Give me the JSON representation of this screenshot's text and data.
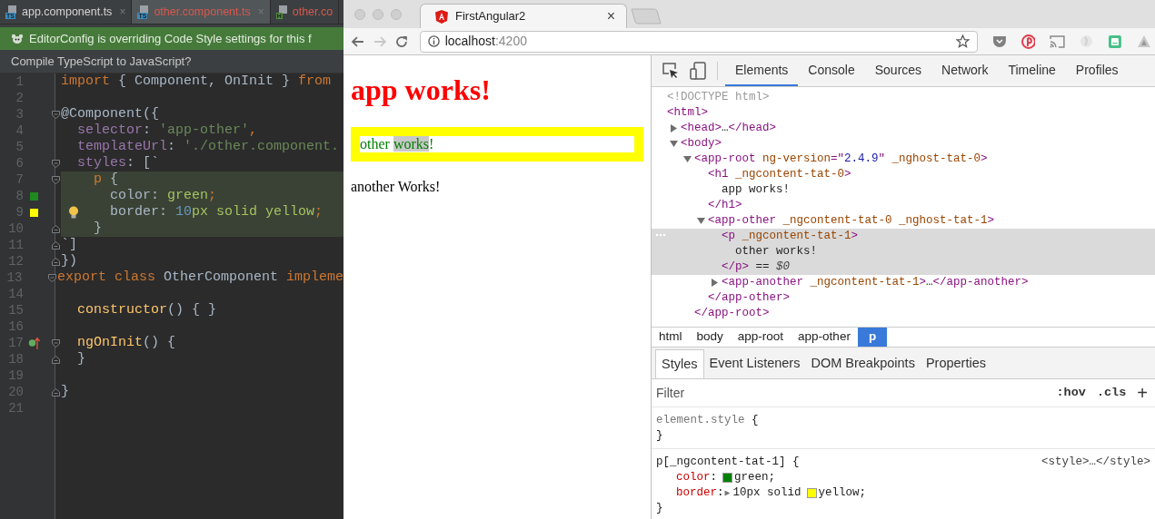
{
  "ide": {
    "tabs": [
      {
        "label": "app.component.ts",
        "file_type": "TS",
        "color": "#3b8ec2",
        "error": false,
        "selected": false,
        "close": "×"
      },
      {
        "label": "other.component.ts",
        "file_type": "TS",
        "color": "#3b8ec2",
        "error": true,
        "selected": true,
        "close": "×"
      },
      {
        "label": "other.co",
        "file_type": "H",
        "color": "#4e8f3a",
        "error": true,
        "selected": false
      }
    ],
    "notification": "EditorConfig is overriding Code Style settings for this f",
    "prompt": "Compile TypeScript to JavaScript?",
    "lines": [
      {
        "n": "1",
        "tokens": [
          {
            "text": "import",
            "kind": "kw"
          },
          {
            "text": " { Component, OnInit } ",
            "kind": "plain"
          },
          {
            "text": "from",
            "kind": "kw"
          }
        ],
        "highlighted": false
      },
      {
        "n": "2",
        "highlighted": false
      },
      {
        "n": "3",
        "tokens": [
          {
            "text": "@Component({",
            "kind": "plain"
          }
        ],
        "fold_start": true,
        "highlighted": false
      },
      {
        "n": "4",
        "tokens": [
          {
            "text": "  selector",
            "kind": "prop"
          },
          {
            "text": ": ",
            "kind": "plain"
          },
          {
            "text": "'app-other'",
            "kind": "str"
          },
          {
            "text": ",",
            "kind": "kw"
          }
        ],
        "highlighted": false
      },
      {
        "n": "5",
        "tokens": [
          {
            "text": "  templateUrl",
            "kind": "prop"
          },
          {
            "text": ": ",
            "kind": "plain"
          },
          {
            "text": "'./other.component.",
            "kind": "str"
          }
        ],
        "highlighted": false
      },
      {
        "n": "6",
        "tokens": [
          {
            "text": "  styles",
            "kind": "prop"
          },
          {
            "text": ": [`",
            "kind": "plain"
          }
        ],
        "fold_start": true,
        "highlighted": false
      },
      {
        "n": "7",
        "tokens": [
          {
            "text": "    p",
            "kind": "kw"
          },
          {
            "text": " {",
            "kind": "plain"
          }
        ],
        "fold_start": true,
        "highlighted": true
      },
      {
        "n": "8",
        "tokens": [
          {
            "text": "      color",
            "kind": "plain"
          },
          {
            "text": ": ",
            "kind": "plain"
          },
          {
            "text": "green",
            "kind": "cssval"
          },
          {
            "text": ";",
            "kind": "kw"
          }
        ],
        "marker": {
          "kind": "swatch",
          "color": "#1f8a1f"
        },
        "highlighted": true
      },
      {
        "n": "9",
        "tokens": [
          {
            "text": "      border",
            "kind": "plain"
          },
          {
            "text": ": ",
            "kind": "plain"
          },
          {
            "text": "10",
            "kind": "num"
          },
          {
            "text": "px solid yellow",
            "kind": "cssval"
          },
          {
            "text": ";",
            "kind": "kw"
          }
        ],
        "marker": {
          "kind": "swatch",
          "color": "#ffff00"
        },
        "bulb": true,
        "highlighted": true
      },
      {
        "n": "10",
        "tokens": [
          {
            "text": "    }",
            "kind": "plain"
          }
        ],
        "fold_end": true,
        "highlighted": true
      },
      {
        "n": "11",
        "tokens": [
          {
            "text": "`]",
            "kind": "plain"
          }
        ],
        "fold_end": true,
        "highlighted": false
      },
      {
        "n": "12",
        "tokens": [
          {
            "text": "})",
            "kind": "plain"
          }
        ],
        "fold_end": true,
        "highlighted": false
      },
      {
        "n": "13",
        "tokens": [
          {
            "text": "export class",
            "kind": "kw"
          },
          {
            "text": " OtherComponent ",
            "kind": "plain"
          },
          {
            "text": "impleme",
            "kind": "kw"
          }
        ],
        "fold_start": true,
        "highlighted": false
      },
      {
        "n": "14",
        "highlighted": false
      },
      {
        "n": "15",
        "tokens": [
          {
            "text": "  constructor",
            "kind": "fn"
          },
          {
            "text": "() { }",
            "kind": "plain"
          }
        ],
        "highlighted": false
      },
      {
        "n": "16",
        "highlighted": false
      },
      {
        "n": "17",
        "tokens": [
          {
            "text": "  ngOnInit",
            "kind": "fn"
          },
          {
            "text": "() {",
            "kind": "plain"
          }
        ],
        "marker": {
          "kind": "override"
        },
        "fold_start": true,
        "highlighted": false
      },
      {
        "n": "18",
        "tokens": [
          {
            "text": "  }",
            "kind": "plain"
          }
        ],
        "fold_end": true,
        "highlighted": false
      },
      {
        "n": "19",
        "highlighted": false
      },
      {
        "n": "20",
        "tokens": [
          {
            "text": "}",
            "kind": "plain"
          }
        ],
        "fold_end": true,
        "highlighted": false
      },
      {
        "n": "21",
        "highlighted": false
      }
    ]
  },
  "browser": {
    "tab": {
      "title": "FirstAngular2",
      "close": "×"
    },
    "url": {
      "host": "localhost",
      "port": ":4200"
    },
    "page": {
      "heading": "app works!",
      "box_parts": [
        {
          "t": "other ",
          "selected": false
        },
        {
          "t": "works",
          "selected": true
        },
        {
          "t": "!",
          "selected": false
        }
      ],
      "paragraph": "another Works!"
    },
    "devtools": {
      "tabs": [
        {
          "label": "Elements",
          "selected": true
        },
        {
          "label": "Console",
          "selected": false
        },
        {
          "label": "Sources",
          "selected": false
        },
        {
          "label": "Network",
          "selected": false
        },
        {
          "label": "Timeline",
          "selected": false
        },
        {
          "label": "Profiles",
          "selected": false
        }
      ],
      "dom": [
        {
          "tokens": [
            {
              "text": "<!DOCTYPE html>",
              "kind": "comment"
            }
          ]
        },
        {
          "tokens": [
            {
              "text": "<html>",
              "kind": "tag"
            }
          ],
          "children": [
            {
              "tokens": [
                {
                  "text": "<head>",
                  "kind": "tag"
                },
                {
                  "text": "…",
                  "kind": "text"
                },
                {
                  "text": "</head>",
                  "kind": "tag"
                }
              ],
              "expanded": false
            },
            {
              "tokens": [
                {
                  "text": "<body>",
                  "kind": "tag"
                }
              ],
              "expanded": true,
              "children": [
                {
                  "tokens": [
                    {
                      "text": "<app-root",
                      "kind": "tag"
                    },
                    {
                      "text": " ng-version",
                      "kind": "attr"
                    },
                    {
                      "text": "=\"",
                      "kind": "tag"
                    },
                    {
                      "text": "2.4.9",
                      "kind": "val"
                    },
                    {
                      "text": "\"",
                      "kind": "tag"
                    },
                    {
                      "text": " _nghost-tat-0",
                      "kind": "attr"
                    },
                    {
                      "text": ">",
                      "kind": "tag"
                    }
                  ],
                  "expanded": true,
                  "children": [
                    {
                      "tokens": [
                        {
                          "text": "<h1",
                          "kind": "tag"
                        },
                        {
                          "text": " _ngcontent-tat-0",
                          "kind": "attr"
                        },
                        {
                          "text": ">",
                          "kind": "tag"
                        }
                      ],
                      "children": [
                        {
                          "tokens": [
                            {
                              "text": "app works!",
                              "kind": "text"
                            }
                          ]
                        }
                      ],
                      "close": [
                        {
                          "text": "</h1>",
                          "kind": "tag"
                        }
                      ]
                    },
                    {
                      "tokens": [
                        {
                          "text": "<app-other",
                          "kind": "tag"
                        },
                        {
                          "text": " _ngcontent-tat-0",
                          "kind": "attr"
                        },
                        {
                          "text": " _nghost-tat-1",
                          "kind": "attr"
                        },
                        {
                          "text": ">",
                          "kind": "tag"
                        }
                      ],
                      "expanded": true,
                      "children": [
                        {
                          "tokens": [
                            {
                              "text": "<p",
                              "kind": "tag"
                            },
                            {
                              "text": " _ngcontent-tat-1",
                              "kind": "attr"
                            },
                            {
                              "text": ">",
                              "kind": "tag"
                            }
                          ],
                          "selected": true,
                          "children": [
                            {
                              "tokens": [
                                {
                                  "text": "other works!",
                                  "kind": "text"
                                }
                              ]
                            }
                          ],
                          "close": [
                            {
                              "text": "</p>",
                              "kind": "tag"
                            },
                            {
                              "text": " == ",
                              "kind": "text"
                            },
                            {
                              "text": "$0",
                              "kind": "var"
                            }
                          ]
                        },
                        {
                          "tokens": [
                            {
                              "text": "<app-another",
                              "kind": "tag"
                            },
                            {
                              "text": " _ngcontent-tat-1",
                              "kind": "attr"
                            },
                            {
                              "text": ">",
                              "kind": "tag"
                            },
                            {
                              "text": "…",
                              "kind": "text"
                            },
                            {
                              "text": "</app-another>",
                              "kind": "tag"
                            }
                          ],
                          "expanded": false
                        }
                      ],
                      "close": [
                        {
                          "text": "</app-other>",
                          "kind": "tag"
                        }
                      ]
                    }
                  ],
                  "close": [
                    {
                      "text": "</app-root>",
                      "kind": "tag"
                    }
                  ]
                }
              ]
            }
          ]
        }
      ],
      "breadcrumbs": [
        {
          "label": "html",
          "selected": false
        },
        {
          "label": "body",
          "selected": false
        },
        {
          "label": "app-root",
          "selected": false
        },
        {
          "label": "app-other",
          "selected": false
        },
        {
          "label": "p",
          "selected": true
        }
      ],
      "pane_tabs": [
        {
          "label": "Styles",
          "selected": true
        },
        {
          "label": "Event Listeners",
          "selected": false
        },
        {
          "label": "DOM Breakpoints",
          "selected": false
        },
        {
          "label": "Properties",
          "selected": false
        }
      ],
      "filter": {
        "placeholder": "Filter"
      },
      "filter_buttons": [
        ":hov",
        ".cls",
        "+"
      ],
      "rules": [
        {
          "selector": "element.style",
          "muted": true,
          "open": " {",
          "close": "}"
        },
        {
          "selector": "p[_ngcontent-tat-1]",
          "muted": false,
          "open": " {",
          "source": "<style>…</style>",
          "close": "}",
          "declarations": [
            {
              "name": "color",
              "colon": ":",
              "color": "#008000",
              "value": "green;"
            },
            {
              "name": "border",
              "colon": ":",
              "expander": "▶",
              "prefix": "10px solid",
              "color": "#ffff00",
              "value": "yellow;"
            }
          ]
        }
      ]
    }
  }
}
